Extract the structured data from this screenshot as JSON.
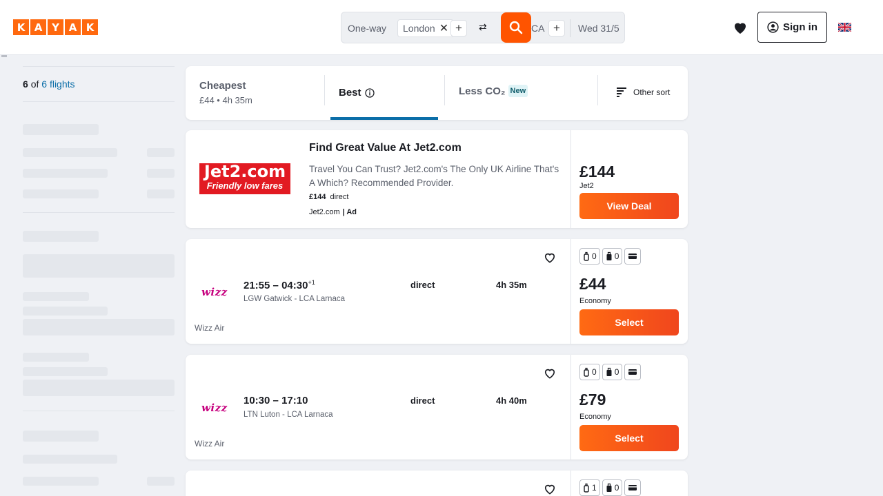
{
  "brand": {
    "logo_letters": [
      "K",
      "A",
      "Y",
      "A",
      "K"
    ]
  },
  "search": {
    "trip_type": "One-way",
    "origin": "London",
    "destination_partial": "CA",
    "date": "Wed 31/5"
  },
  "header": {
    "sign_in_label": "Sign in"
  },
  "results": {
    "shown": "6",
    "of": "of",
    "total_label": "6 flights"
  },
  "sort_tabs": {
    "cheapest": {
      "title": "Cheapest",
      "sub": "£44 • 4h 35m"
    },
    "best": {
      "title": "Best"
    },
    "co2": {
      "title": "Less CO₂",
      "badge": "New"
    },
    "other": {
      "label": "Other sort"
    }
  },
  "ad": {
    "logo_line1": "Jet2.com",
    "logo_line2": "Friendly low fares",
    "title": "Find Great Value At Jet2.com",
    "description": "Travel You Can Trust? Jet2.com's The Only UK Airline That's A Which? Recommended Provider.",
    "price_line_price": "£144",
    "price_line_stops": "direct",
    "source": "Jet2.com",
    "ad_label": "| Ad",
    "price": "£144",
    "provider": "Jet2",
    "cta": "View Deal"
  },
  "flights": [
    {
      "logo": "wizz",
      "depart": "21:55",
      "arrive": "04:30",
      "day_offset": "+1",
      "route": "LGW Gatwick - LCA Larnaca",
      "stops": "direct",
      "duration": "4h 35m",
      "airline": "Wizz Air",
      "bag_personal": "0",
      "bag_carryon": "0",
      "price": "£44",
      "cabin": "Economy",
      "cta": "Select"
    },
    {
      "logo": "wizz",
      "depart": "10:30",
      "arrive": "17:10",
      "day_offset": "",
      "route": "LTN Luton - LCA Larnaca",
      "stops": "direct",
      "duration": "4h 40m",
      "airline": "Wizz Air",
      "bag_personal": "0",
      "bag_carryon": "0",
      "price": "£79",
      "cabin": "Economy",
      "cta": "Select"
    },
    {
      "bag_personal": "1",
      "bag_carryon": "0"
    }
  ],
  "colors": {
    "accent": "#ff690f",
    "cta": "#f0461d",
    "link": "#0b6ea8"
  }
}
